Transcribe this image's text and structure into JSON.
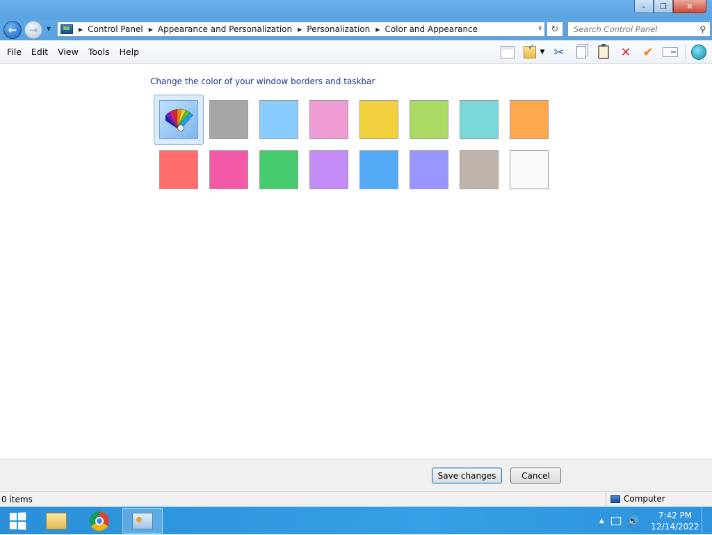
{
  "window": {
    "controls": {
      "minimize": "–",
      "maximize": "❐",
      "close": "✕"
    }
  },
  "nav": {
    "back_icon": "arrow-left",
    "forward_icon": "arrow-right",
    "breadcrumbs": [
      "Control Panel",
      "Appearance and Personalization",
      "Personalization",
      "Color and Appearance"
    ],
    "search_placeholder": "Search Control Panel"
  },
  "menu": {
    "items": [
      "File",
      "Edit",
      "View",
      "Tools",
      "Help"
    ]
  },
  "toolbar": {
    "icons": [
      "layout-icon",
      "folder-check-icon",
      "cut-icon",
      "copy-icon",
      "paste-icon",
      "delete-icon",
      "check-icon",
      "properties-icon",
      "globe-icon"
    ]
  },
  "content": {
    "heading": "Change the color of your window borders and taskbar",
    "selected_index": 0,
    "swatches": [
      {
        "name": "automatic",
        "color": "#8fc6f4"
      },
      {
        "name": "sky-gray",
        "color": "#a6a6a6"
      },
      {
        "name": "light-blue",
        "color": "#88ccff"
      },
      {
        "name": "pink",
        "color": "#f09cd4"
      },
      {
        "name": "yellow",
        "color": "#f2d03e"
      },
      {
        "name": "lime",
        "color": "#aad964"
      },
      {
        "name": "teal",
        "color": "#79d8d8"
      },
      {
        "name": "orange",
        "color": "#ffa94e"
      },
      {
        "name": "red",
        "color": "#ff6d6d"
      },
      {
        "name": "magenta",
        "color": "#f25aa8"
      },
      {
        "name": "green",
        "color": "#44cc6e"
      },
      {
        "name": "violet",
        "color": "#c38bf5"
      },
      {
        "name": "blue",
        "color": "#55aaf8"
      },
      {
        "name": "periwinkle",
        "color": "#9797ff"
      },
      {
        "name": "taupe",
        "color": "#c1b4aa"
      },
      {
        "name": "white",
        "color": "#fafafa"
      }
    ]
  },
  "buttons": {
    "save": "Save changes",
    "cancel": "Cancel"
  },
  "status": {
    "items": "0 items",
    "location": "Computer"
  },
  "taskbar": {
    "apps": [
      "file-explorer",
      "google-chrome",
      "control-panel"
    ],
    "active_app": "control-panel",
    "time": "7:42 PM",
    "date": "12/14/2022"
  }
}
